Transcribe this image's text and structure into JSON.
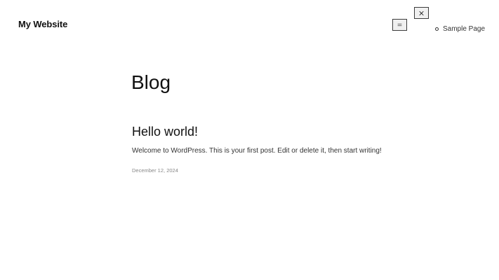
{
  "header": {
    "site_title": "My Website"
  },
  "nav": {
    "open_menu_icon": "hamburger-icon",
    "close_menu_icon": "close-icon",
    "items": [
      {
        "label": "Sample Page"
      }
    ]
  },
  "main": {
    "page_title": "Blog",
    "posts": [
      {
        "title": "Hello world!",
        "excerpt": "Welcome to WordPress. This is your first post. Edit or delete it, then start writing!",
        "date": "December 12, 2024"
      }
    ]
  }
}
